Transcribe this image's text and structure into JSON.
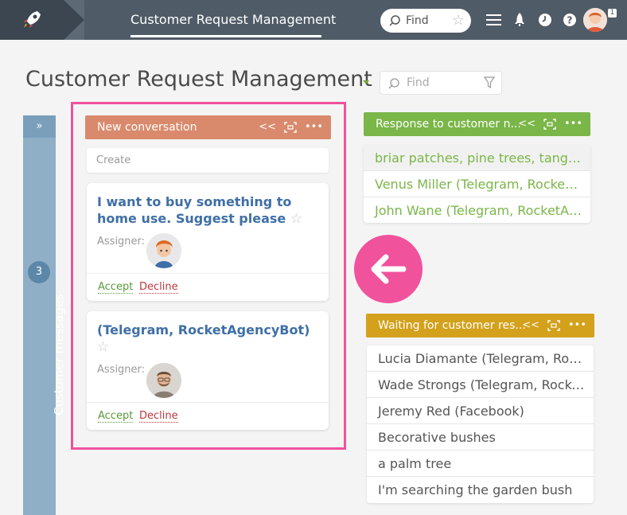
{
  "topbar": {
    "title": "Customer Request Management",
    "find_label": "Find",
    "notification_count": "1",
    "icons": [
      "rocket-logo-icon",
      "menu-icon",
      "rocket-icon",
      "clock-icon",
      "help-icon"
    ]
  },
  "page": {
    "title": "Customer Request Management",
    "find_placeholder": "Find",
    "accent_color": "#7aa63a"
  },
  "side_column": {
    "label": "Customer messages",
    "count": "3",
    "collapse_glyph": "»"
  },
  "new_conversation": {
    "header": "New conversation",
    "color": "#d98a6c",
    "create_label": "Create",
    "cards": [
      {
        "title": "I want to buy something to home use. Suggest please",
        "assigner_label": "Assigner:",
        "accept_label": "Accept",
        "decline_label": "Decline"
      },
      {
        "title": "(Telegram, RocketAgencyBot)",
        "assigner_label": "Assigner:",
        "accept_label": "Accept",
        "decline_label": "Decline"
      }
    ]
  },
  "response_column": {
    "header": "Response to customer n...",
    "color": "#7ab648",
    "items": [
      "briar patches, pine trees, tangle...",
      "Venus Miller (Telegram, RocketA...",
      "John Wane (Telegram, RocketAg..."
    ]
  },
  "waiting_column": {
    "header": "Waiting for customer res...",
    "color": "#d3a11c",
    "items": [
      "Lucia Diamante (Telegram, Rock...",
      "Wade Strongs (Telegram, Rocket...",
      "Jeremy Red (Facebook)",
      "Becorative bushes",
      "a palm tree",
      "I'm searching the garden bush"
    ]
  },
  "highlight_color": "#f0529c"
}
